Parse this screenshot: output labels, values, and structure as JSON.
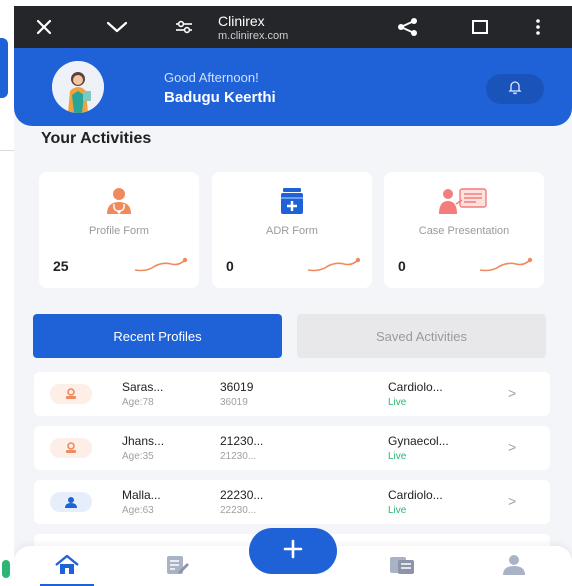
{
  "browser": {
    "title": "Clinirex",
    "url": "m.clinirex.com",
    "icons": [
      "close-icon",
      "chevron-down-icon",
      "tune-icon",
      "share-icon",
      "bookmark-icon",
      "more-vertical-icon"
    ]
  },
  "header": {
    "greeting": "Good Afternoon!",
    "user_name": "Badugu Keerthi",
    "icons": [
      "user-avatar",
      "bell-icon"
    ]
  },
  "activities": {
    "title": "Your Activities",
    "cards": [
      {
        "label": "Profile Form",
        "count": "25",
        "icon": "doctor-icon"
      },
      {
        "label": "ADR Form",
        "count": "0",
        "icon": "medicine-kit-icon"
      },
      {
        "label": "Case Presentation",
        "count": "0",
        "icon": "presentation-icon"
      }
    ]
  },
  "tabs": {
    "recent": "Recent Profiles",
    "saved": "Saved Activities"
  },
  "profiles": [
    {
      "name": "Saras...",
      "age": "Age:78",
      "id": "36019",
      "id_sub": "36019",
      "dept": "Cardiolo...",
      "status": "Live",
      "icon": "patient-female-icon"
    },
    {
      "name": "Jhans...",
      "age": "Age:35",
      "id": "21230...",
      "id_sub": "21230...",
      "dept": "Gynaecol...",
      "status": "Live",
      "icon": "patient-female-icon"
    },
    {
      "name": "Malla...",
      "age": "Age:63",
      "id": "22230...",
      "id_sub": "22230...",
      "dept": "Cardiolo...",
      "status": "Live",
      "icon": "patient-male-icon"
    }
  ],
  "chevron": ">",
  "bottom_nav": {
    "icons": [
      "home-icon",
      "edit-note-icon",
      "add-icon",
      "documents-icon",
      "profile-icon"
    ]
  },
  "colors": {
    "primary": "#1f62d8",
    "live": "#2bb673",
    "accent": "#f08a5d"
  }
}
